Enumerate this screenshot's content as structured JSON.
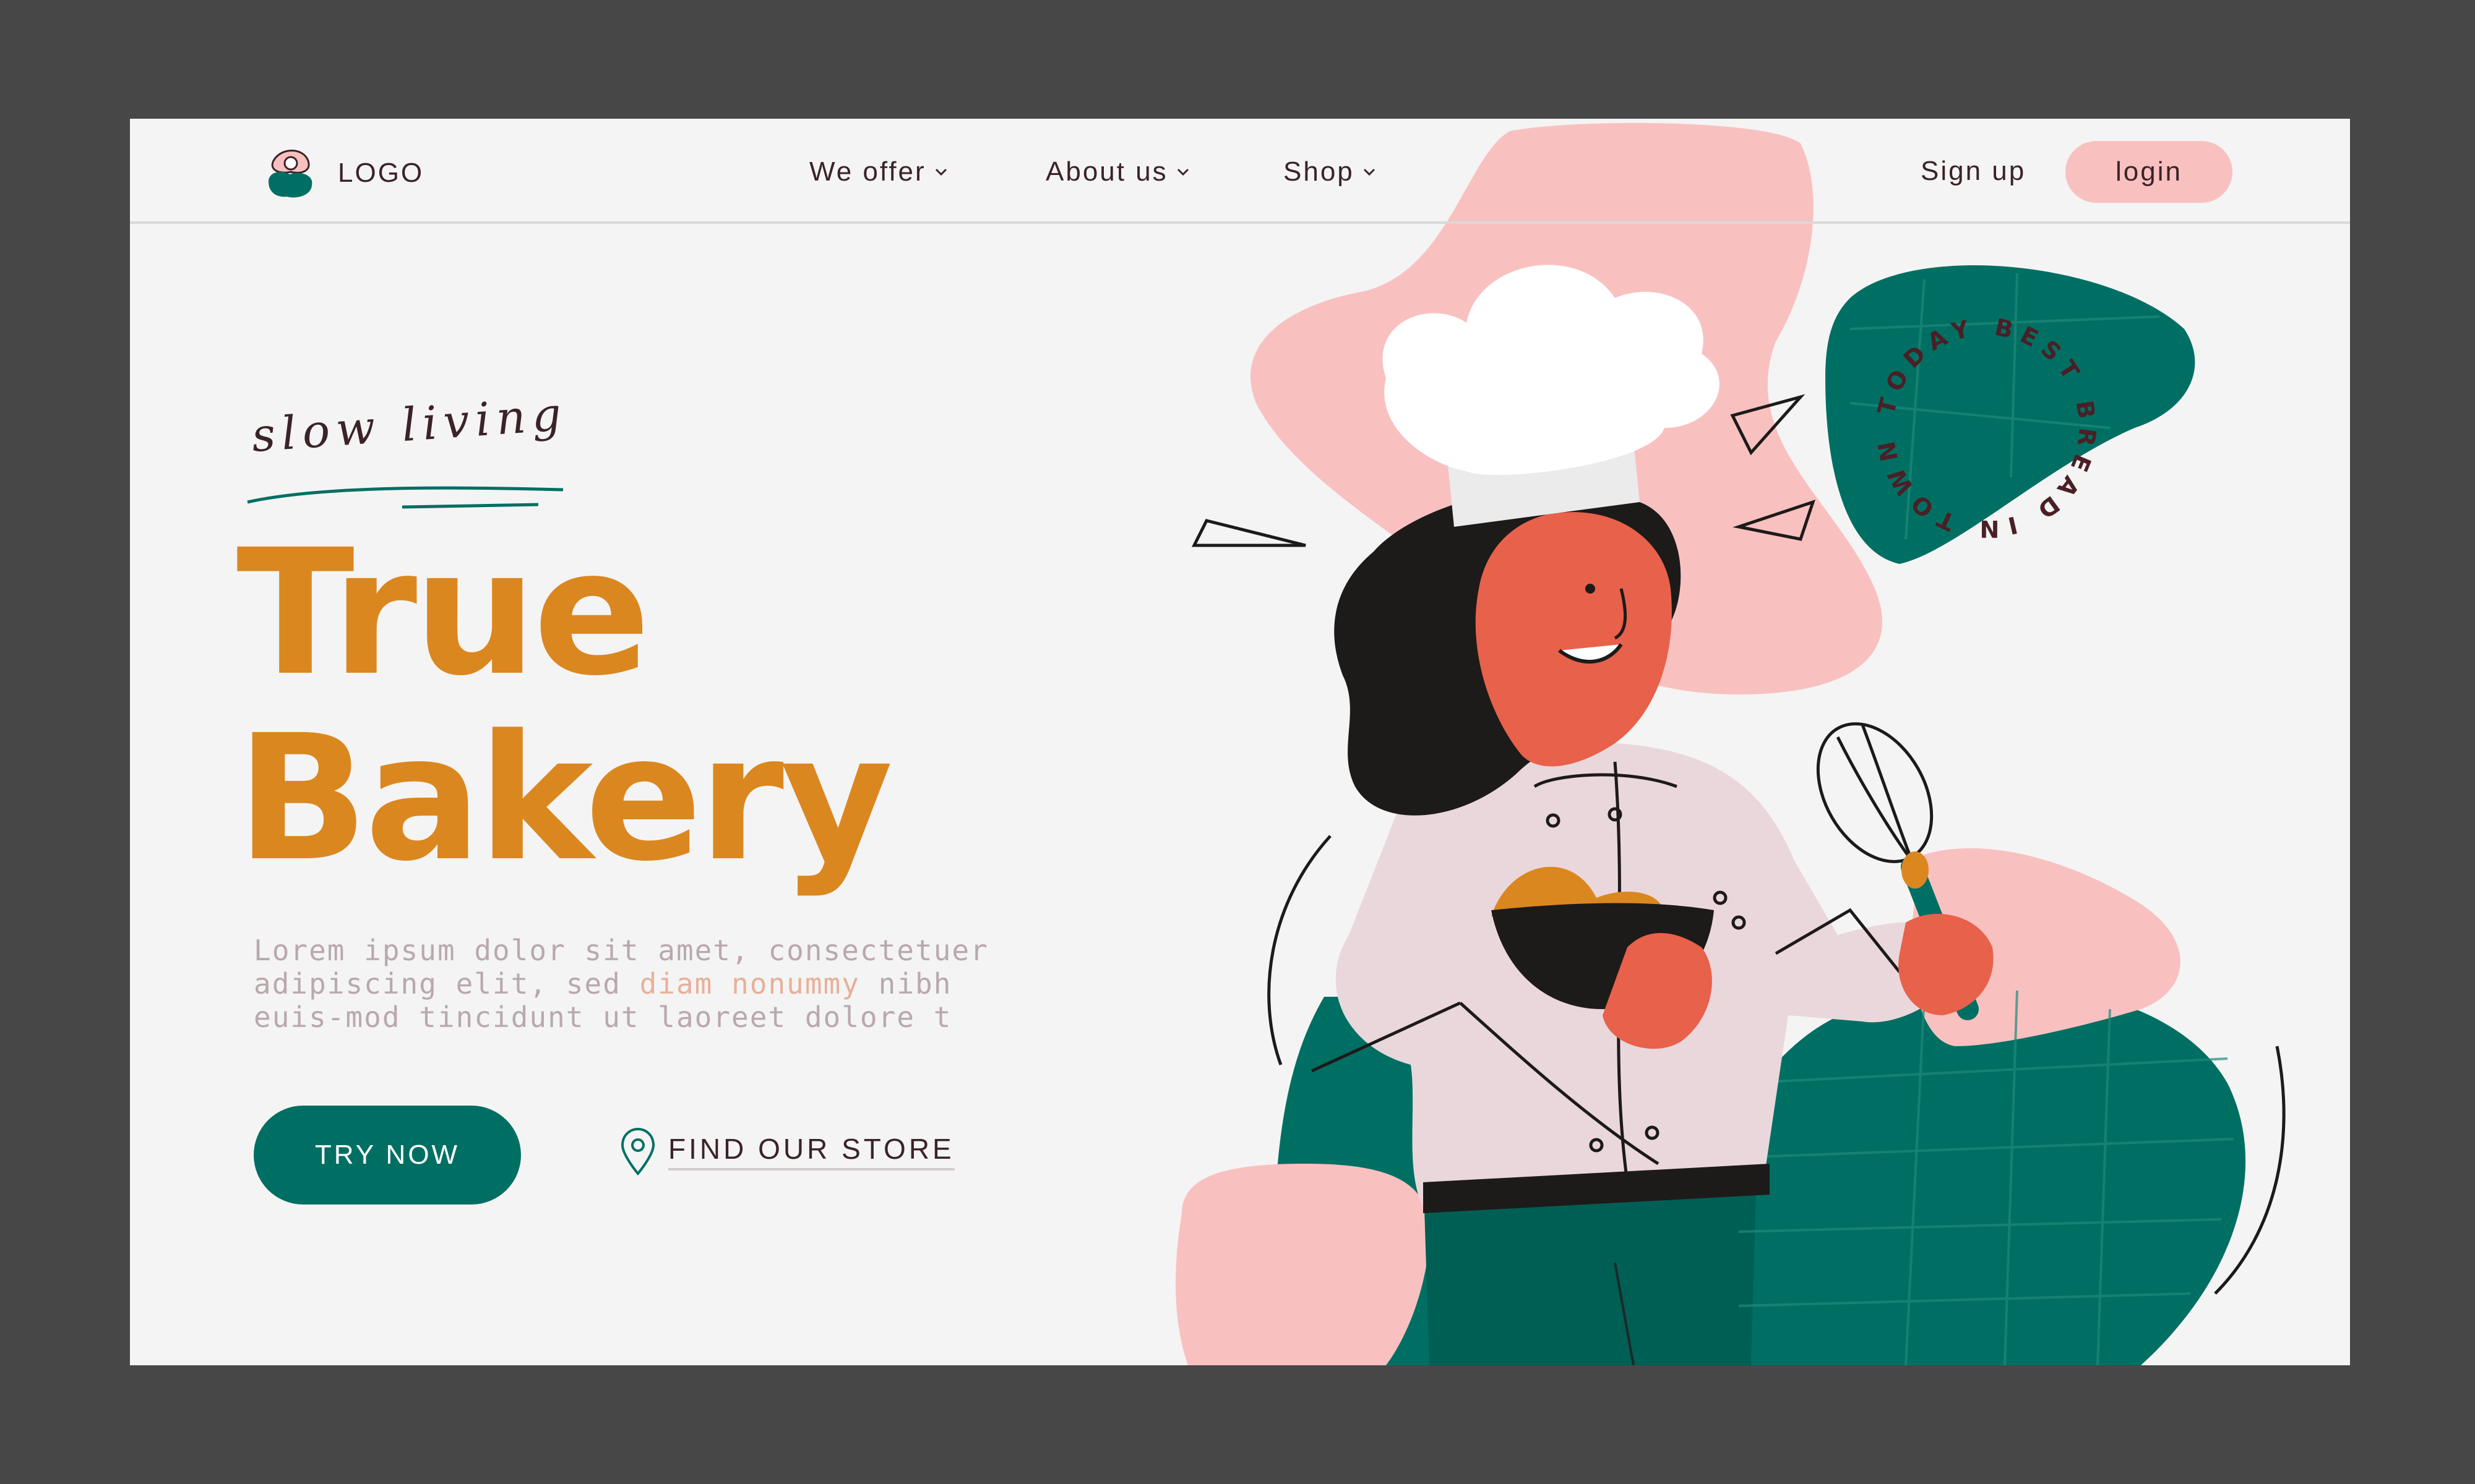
{
  "header": {
    "logo_text": "LOGO",
    "nav": [
      {
        "label": "We offer"
      },
      {
        "label": "About us"
      },
      {
        "label": "Shop"
      }
    ],
    "signup_label": "Sign up",
    "login_label": "login"
  },
  "hero": {
    "tagline": "slow living",
    "title_line1": "True",
    "title_line2": "Bakery",
    "description_part1": "Lorem ipsum dolor sit amet, consectetuer adipiscing elit, sed ",
    "description_highlight": "diam nonummy",
    "description_part2": " nibh euis-mod tincidunt ut laoreet dolore t",
    "try_button_label": "TRY NOW",
    "find_store_label": "FIND OUR STORE",
    "badge_text": "TODAY BEST BREAD IN TOWN"
  },
  "colors": {
    "background": "#474747",
    "page": "#f4f4f4",
    "accent_orange": "#db8720",
    "accent_green": "#006f63",
    "accent_pink": "#f8c1c0",
    "text_dark": "#3b2328",
    "text_muted": "#b9a9ac"
  },
  "icons": {
    "logo": "logo-icon",
    "nav_dropdown": "chevron-down-icon",
    "store": "location-pin-icon"
  }
}
